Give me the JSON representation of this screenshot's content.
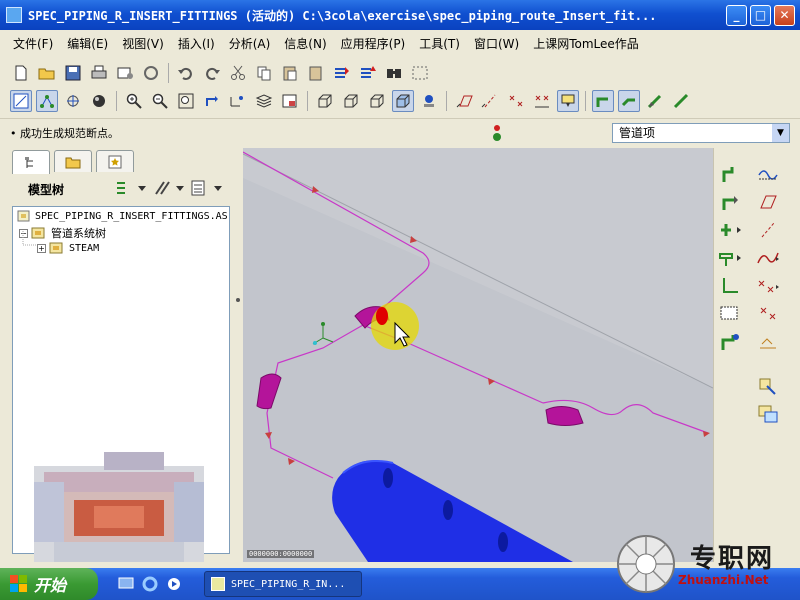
{
  "window": {
    "title": "SPEC_PIPING_R_INSERT_FITTINGS (活动的) C:\\3cola\\exercise\\spec_piping_route_Insert_fit...",
    "minimize": "_",
    "maximize": "□",
    "close": "✕"
  },
  "menu": {
    "items": [
      "文件(F)",
      "编辑(E)",
      "视图(V)",
      "插入(I)",
      "分析(A)",
      "信息(N)",
      "应用程序(P)",
      "工具(T)",
      "窗口(W)",
      "上课网TomLee作品"
    ]
  },
  "status": {
    "message": "• 成功生成规范断点。",
    "filter_value": "管道项"
  },
  "model_tree": {
    "title": "模型树",
    "root_label": "SPEC_PIPING_R_INSERT_FITTINGS.AS",
    "child_label": "管道系统树",
    "grandchild_label": "STEAM"
  },
  "viewport": {
    "scale_label": "0000000:0000000"
  },
  "taskbar": {
    "start_label": "开始",
    "task_label": "SPEC_PIPING_R_IN..."
  },
  "watermark": {
    "main": "专职网",
    "sub": "Zhuanzhi.Net"
  },
  "colors": {
    "pipe_route": "#c838c8",
    "fitting": "#b4149a",
    "tank": "#1f2fe6",
    "floor": "#c2c5cc",
    "highlight": "#e6d800"
  }
}
